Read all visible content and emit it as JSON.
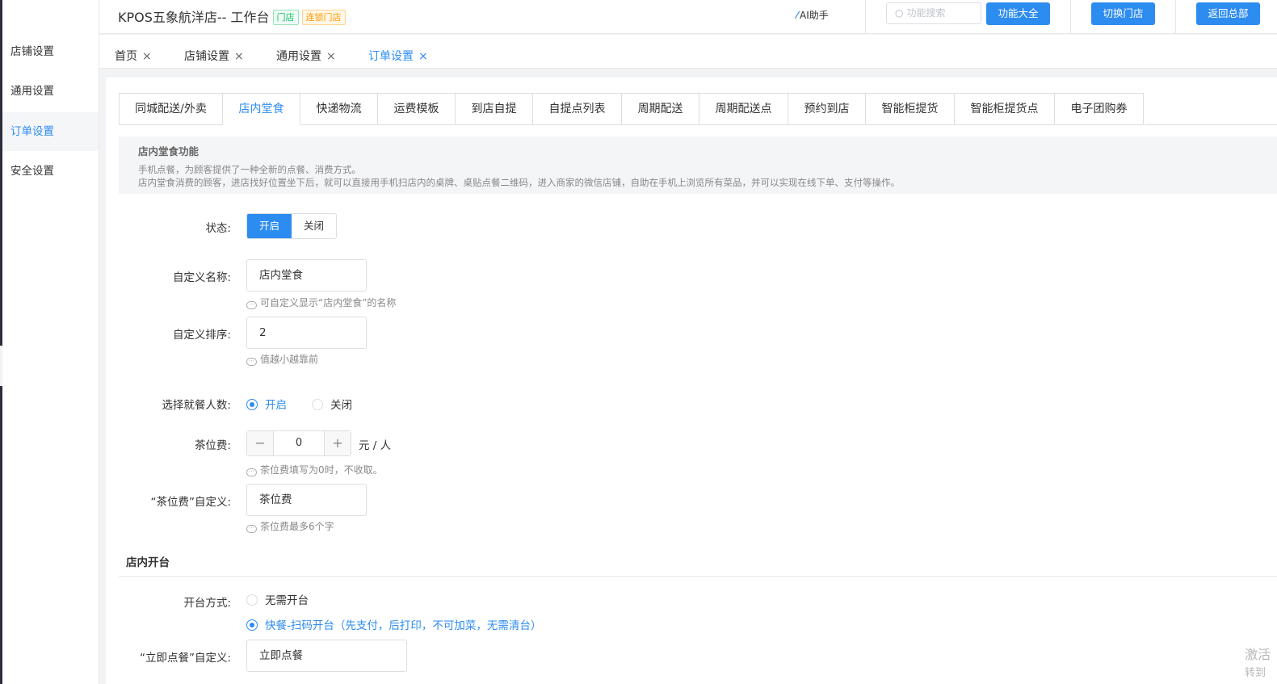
{
  "header": {
    "shop_title": "KPOS五象航洋店-- 工作台",
    "badge_store": "门店",
    "badge_chain": "连锁门店",
    "ai_label": "AI助手",
    "search_placeholder": "功能搜索",
    "btn_all_functions": "功能大全",
    "btn_switch_store": "切换门店",
    "btn_back_hq": "返回总部"
  },
  "sidebar": {
    "items": [
      {
        "label": "店铺设置"
      },
      {
        "label": "通用设置"
      },
      {
        "label": "订单设置"
      },
      {
        "label": "安全设置"
      }
    ]
  },
  "page_tabs": [
    {
      "label": "首页"
    },
    {
      "label": "店铺设置"
    },
    {
      "label": "通用设置"
    },
    {
      "label": "订单设置"
    }
  ],
  "close_glyph": "×",
  "sub_tabs": [
    {
      "label": "同城配送/外卖"
    },
    {
      "label": "店内堂食"
    },
    {
      "label": "快递物流"
    },
    {
      "label": "运费模板"
    },
    {
      "label": "到店自提"
    },
    {
      "label": "自提点列表"
    },
    {
      "label": "周期配送"
    },
    {
      "label": "周期配送点"
    },
    {
      "label": "预约到店"
    },
    {
      "label": "智能柜提货"
    },
    {
      "label": "智能柜提货点"
    },
    {
      "label": "电子团购券"
    }
  ],
  "info": {
    "title": "店内堂食功能",
    "line1": "手机点餐，为顾客提供了一种全新的点餐、消费方式。",
    "line2": "店内堂食消费的顾客，进店找好位置坐下后，就可以直接用手机扫店内的桌牌、桌贴点餐二维码，进入商家的微信店铺，自助在手机上浏览所有菜品，并可以实现在线下单、支付等操作。"
  },
  "form": {
    "status_label": "状态:",
    "status_on": "开启",
    "status_off": "关闭",
    "custom_name_label": "自定义名称:",
    "custom_name_value": "店内堂食",
    "custom_name_hint": "可自定义显示“店内堂食”的名称",
    "sort_label": "自定义排序:",
    "sort_value": "2",
    "sort_hint": "值越小越靠前",
    "diners_label": "选择就餐人数:",
    "diners_on": "开启",
    "diners_off": "关闭",
    "tea_fee_label": "茶位费:",
    "tea_fee_minus": "−",
    "tea_fee_value": "0",
    "tea_fee_plus": "+",
    "tea_fee_unit": "元 / 人",
    "tea_fee_hint": "茶位费填写为0时，不收取。",
    "tea_fee_custom_label": "“茶位费”自定义:",
    "tea_fee_custom_value": "茶位费",
    "tea_fee_custom_hint": "茶位费最多6个字",
    "section_open_table": "店内开台",
    "open_mode_label": "开台方式:",
    "open_mode_none": "无需开台",
    "open_mode_quick": "快餐-扫码开台（先支付，后打印，不可加菜，无需清台）",
    "order_now_label": "“立即点餐”自定义:",
    "order_now_value": "立即点餐"
  },
  "watermark": {
    "line1": "激活",
    "line2": "转到"
  },
  "colors": {
    "accent": "#2d8cf0",
    "badge_green": "#19be6b",
    "badge_orange": "#ff9900"
  }
}
